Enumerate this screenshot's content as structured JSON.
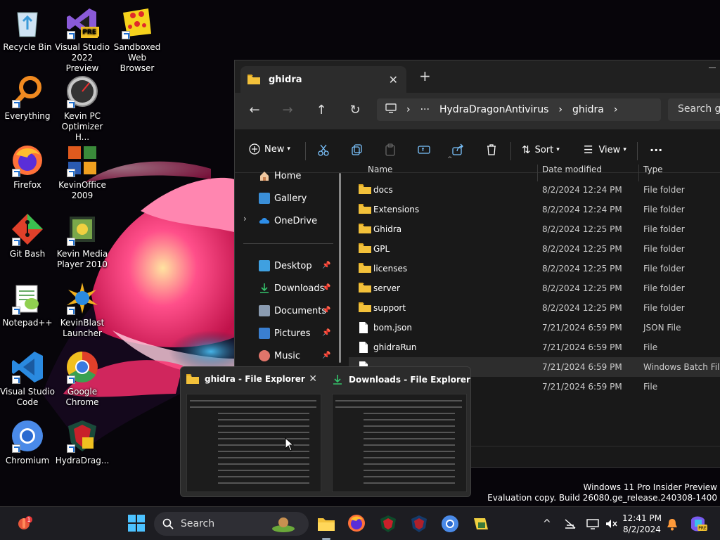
{
  "desktop": {
    "icons": [
      {
        "label": "Recycle Bin",
        "icon": "recycle-bin-icon"
      },
      {
        "label": "Visual Studio 2022 Preview",
        "icon": "visual-studio-icon",
        "badge": "PRE"
      },
      {
        "label": "Sandboxed Web Browser",
        "icon": "sandboxed-browser-icon"
      },
      {
        "label": "Everything",
        "icon": "everything-search-icon"
      },
      {
        "label": "Kevin PC Optimizer H...",
        "icon": "speedometer-icon"
      },
      {
        "label": "Firefox",
        "icon": "firefox-icon"
      },
      {
        "label": "KevinOffice 2009",
        "icon": "office-icon"
      },
      {
        "label": "Git Bash",
        "icon": "git-bash-icon"
      },
      {
        "label": "Kevin Media Player 2010",
        "icon": "media-player-icon"
      },
      {
        "label": "Notepad++",
        "icon": "notepadpp-icon"
      },
      {
        "label": "KevinBlast Launcher",
        "icon": "blast-launcher-icon"
      },
      {
        "label": "Visual Studio Code",
        "icon": "vscode-icon"
      },
      {
        "label": "Google Chrome",
        "icon": "chrome-icon"
      },
      {
        "label": "Chromium",
        "icon": "chromium-icon"
      },
      {
        "label": "HydraDrag...",
        "icon": "hydradragon-icon"
      }
    ]
  },
  "explorer": {
    "tab_title": "ghidra",
    "breadcrumb": [
      "HydraDragonAntivirus",
      "ghidra"
    ],
    "breadcrumb_more": "···",
    "search_placeholder": "Search gh",
    "toolbar": {
      "new": "New",
      "sort": "Sort",
      "view": "View",
      "more": "···"
    },
    "sidebar": {
      "top": [
        {
          "label": "Home"
        },
        {
          "label": "Gallery"
        },
        {
          "label": "OneDrive"
        }
      ],
      "pinned": [
        {
          "label": "Desktop"
        },
        {
          "label": "Downloads"
        },
        {
          "label": "Documents"
        },
        {
          "label": "Pictures"
        },
        {
          "label": "Music"
        }
      ]
    },
    "columns": {
      "name": "Name",
      "date": "Date modified",
      "type": "Type"
    },
    "files": [
      {
        "name": "docs",
        "date": "8/2/2024 12:24 PM",
        "type": "File folder",
        "kind": "folder"
      },
      {
        "name": "Extensions",
        "date": "8/2/2024 12:24 PM",
        "type": "File folder",
        "kind": "folder"
      },
      {
        "name": "Ghidra",
        "date": "8/2/2024 12:25 PM",
        "type": "File folder",
        "kind": "folder"
      },
      {
        "name": "GPL",
        "date": "8/2/2024 12:25 PM",
        "type": "File folder",
        "kind": "folder"
      },
      {
        "name": "licenses",
        "date": "8/2/2024 12:25 PM",
        "type": "File folder",
        "kind": "folder"
      },
      {
        "name": "server",
        "date": "8/2/2024 12:25 PM",
        "type": "File folder",
        "kind": "folder"
      },
      {
        "name": "support",
        "date": "8/2/2024 12:25 PM",
        "type": "File folder",
        "kind": "folder"
      },
      {
        "name": "bom.json",
        "date": "7/21/2024 6:59 PM",
        "type": "JSON File",
        "kind": "file"
      },
      {
        "name": "ghidraRun",
        "date": "7/21/2024 6:59 PM",
        "type": "File",
        "kind": "file"
      },
      {
        "name": "",
        "date": "7/21/2024 6:59 PM",
        "type": "Windows Batch File",
        "kind": "file"
      },
      {
        "name": "",
        "date": "7/21/2024 6:59 PM",
        "type": "File",
        "kind": "file"
      }
    ]
  },
  "preview": {
    "windows": [
      {
        "title": "ghidra - File Explorer",
        "icon": "folder-icon"
      },
      {
        "title": "Downloads - File Explorer",
        "icon": "download-icon"
      }
    ]
  },
  "watermark": {
    "line1": "Windows 11 Pro Insider Preview",
    "line2": "Evaluation copy. Build 26080.ge_release.240308-1400"
  },
  "taskbar": {
    "search_label": "Search",
    "time": "12:41 PM",
    "date": "8/2/2024",
    "notification_count": "1"
  },
  "colors": {
    "folder": "#f3c13a",
    "accent": "#4cc2ff"
  }
}
